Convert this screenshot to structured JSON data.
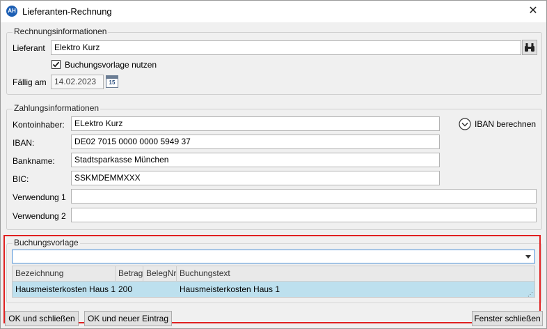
{
  "window": {
    "icon_text": "AH",
    "title": "Lieferanten-Rechnung",
    "close_glyph": "✕"
  },
  "rechnung": {
    "legend": "Rechnungsinformationen",
    "lieferant_label": "Lieferant",
    "lieferant_value": "Elektro Kurz",
    "buchungsvorlage_checkbox_label": "Buchungsvorlage nutzen",
    "buchungsvorlage_checked": true,
    "faellig_label": "Fällig am",
    "faellig_value": "14.02.2023",
    "calendar_day": "15"
  },
  "zahlung": {
    "legend": "Zahlungsinformationen",
    "kontoinhaber_label": "Kontoinhaber:",
    "kontoinhaber_value": "ELektro Kurz",
    "iban_label": "IBAN:",
    "iban_value": "DE02 7015 0000 0000 5949 37",
    "bankname_label": "Bankname:",
    "bankname_value": "Stadtsparkasse München",
    "bic_label": "BIC:",
    "bic_value": "SSKMDEMMXXX",
    "verwendung1_label": "Verwendung 1",
    "verwendung1_value": "",
    "verwendung2_label": "Verwendung 2",
    "verwendung2_value": "",
    "iban_berechnen_label": "IBAN berechnen"
  },
  "buchungsvorlage": {
    "legend": "Buchungsvorlage",
    "selected_value": "",
    "columns": [
      "Bezeichnung",
      "Betrag",
      "BelegNr",
      "Buchungstext"
    ],
    "rows": [
      [
        "Hausmeisterkosten Haus 1",
        "200",
        "",
        "Hausmeisterkosten Haus 1"
      ]
    ]
  },
  "footer": {
    "ok_close": "OK und schließen",
    "ok_new": "OK und neuer Eintrag",
    "close_window": "Fenster schließen"
  },
  "colors": {
    "accent": "#1d5fb4",
    "highlight_border": "#e02020",
    "selected_row": "#bde0ee"
  }
}
